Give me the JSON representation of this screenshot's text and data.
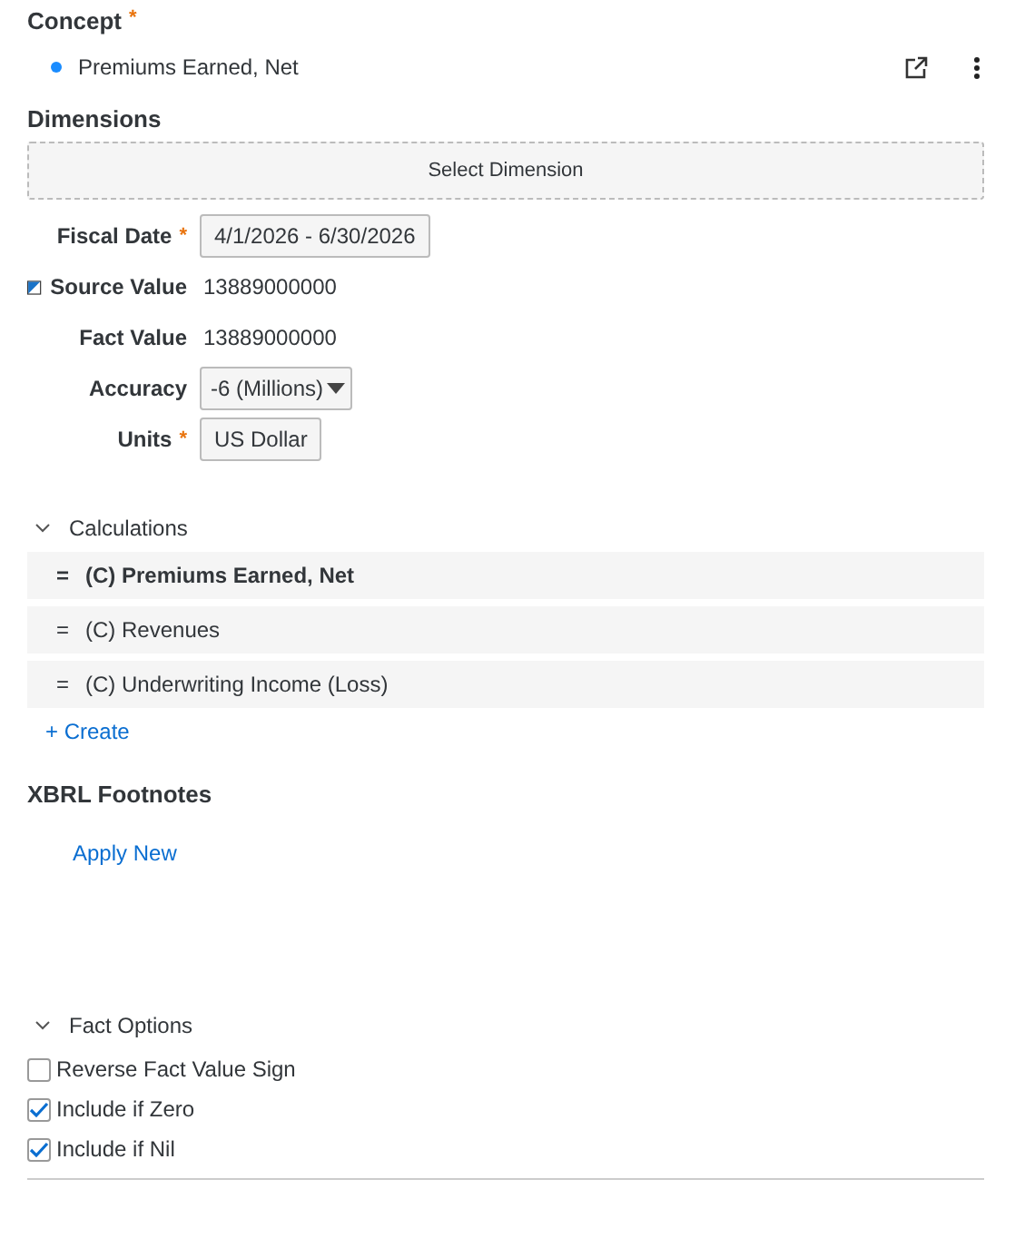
{
  "concept": {
    "label": "Concept",
    "required_mark": "*",
    "item": {
      "name": "Premiums Earned, Net",
      "color": "#1a8cff"
    }
  },
  "dimensions": {
    "label": "Dimensions",
    "button": "Select Dimension"
  },
  "fields": [
    {
      "label": "Fiscal Date",
      "required_mark": "*",
      "kind": "box",
      "value": "4/1/2026 - 6/30/2026"
    },
    {
      "label": "Source Value",
      "kind": "text",
      "value": "13889000000",
      "flag": true
    },
    {
      "label": "Fact Value",
      "kind": "text",
      "value": "13889000000"
    },
    {
      "label": "Accuracy",
      "kind": "select",
      "value": "-6 (Millions)"
    },
    {
      "label": "Units",
      "required_mark": "*",
      "kind": "box",
      "value": "US Dollar"
    }
  ],
  "calculations": {
    "label": "Calculations",
    "expanded": true,
    "rows": [
      {
        "sign": "=",
        "name": "(C) Premiums Earned, Net",
        "selected": true
      },
      {
        "sign": "=",
        "name": "(C) Revenues",
        "selected": false
      },
      {
        "sign": "=",
        "name": "(C) Underwriting Income (Loss)",
        "selected": false
      }
    ],
    "create": "+ Create"
  },
  "footnotes": {
    "label": "XBRL Footnotes",
    "link": "Apply New"
  },
  "fact_options": {
    "label": "Fact Options",
    "expanded": true,
    "options": [
      {
        "label": "Reverse Fact Value Sign",
        "checked": false
      },
      {
        "label": "Include if Zero",
        "checked": true
      },
      {
        "label": "Include if Nil",
        "checked": true
      }
    ]
  }
}
